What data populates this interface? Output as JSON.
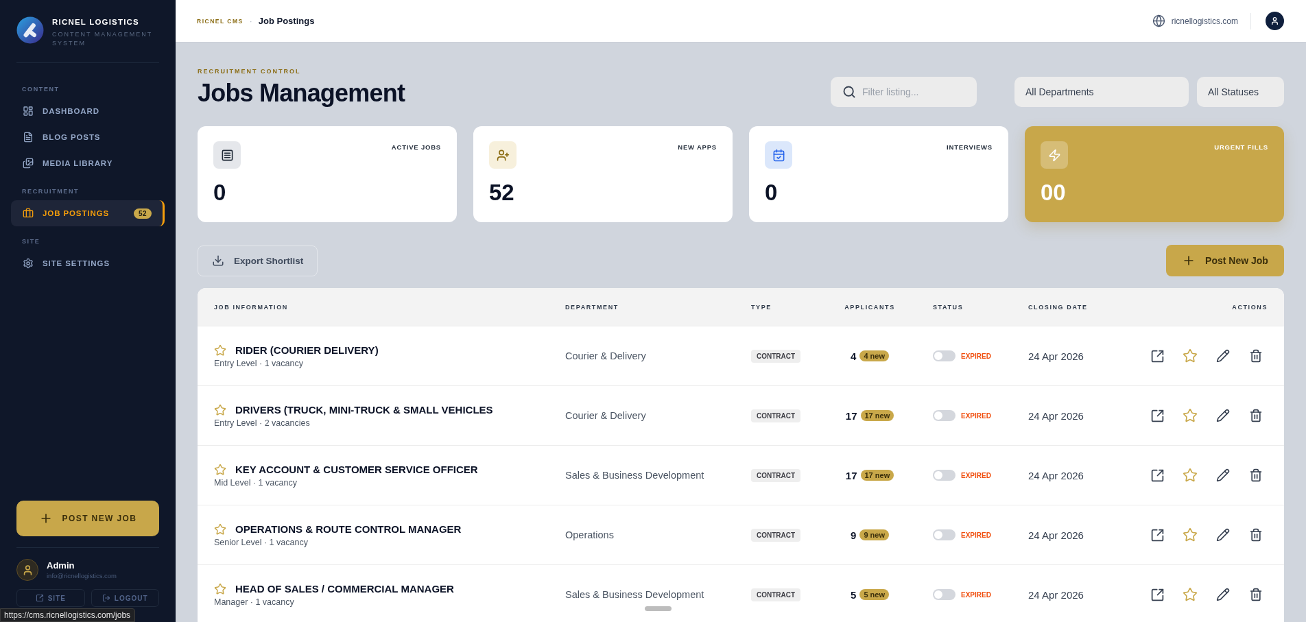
{
  "sidebar": {
    "brand": {
      "name": "RICNEL LOGISTICS",
      "tagline": "CONTENT MANAGEMENT SYSTEM"
    },
    "sections": [
      {
        "label": "CONTENT",
        "items": [
          {
            "label": "DASHBOARD",
            "kind": "dashboard",
            "selected": false
          },
          {
            "label": "BLOG POSTS",
            "kind": "article",
            "selected": false
          },
          {
            "label": "MEDIA LIBRARY",
            "kind": "media",
            "selected": false
          }
        ]
      },
      {
        "label": "RECRUITMENT",
        "items": [
          {
            "label": "JOB POSTINGS",
            "kind": "briefcase",
            "selected": true,
            "badge": "52"
          }
        ]
      },
      {
        "label": "SITE",
        "items": [
          {
            "label": "SITE SETTINGS",
            "kind": "settings",
            "selected": false
          }
        ]
      }
    ],
    "post_button": "POST NEW JOB",
    "user": {
      "name": "Admin",
      "email": "info@ricnellogistics.com"
    },
    "footer_buttons": [
      {
        "label": "SITE",
        "kind": "site"
      },
      {
        "label": "LOGOUT",
        "kind": "logout"
      }
    ]
  },
  "header": {
    "breadcrumb": [
      "RICNEL CMS",
      "Job Postings"
    ],
    "separator": "·",
    "site": "ricnellogistics.com"
  },
  "page": {
    "eyebrow": "RECRUITMENT CONTROL",
    "title": "Jobs Management",
    "search": {
      "placeholder": "Filter listing..."
    },
    "filters": [
      "All Departments",
      "All Statuses"
    ]
  },
  "stats": [
    {
      "label": "ACTIVE JOBS",
      "value": "0",
      "kind": "list",
      "highlighted": false
    },
    {
      "label": "NEW APPS",
      "value": "52",
      "kind": "user-plus",
      "highlighted": false
    },
    {
      "label": "INTERVIEWS",
      "value": "0",
      "kind": "calendar",
      "highlighted": false
    },
    {
      "label": "URGENT FILLS",
      "value": "00",
      "kind": "zap",
      "highlighted": true
    }
  ],
  "toolbar": {
    "export": "Export Shortlist",
    "post": "Post New Job"
  },
  "table": {
    "columns": [
      "JOB INFORMATION",
      "DEPARTMENT",
      "TYPE",
      "APPLICANTS",
      "STATUS",
      "CLOSING DATE",
      "ACTIONS"
    ],
    "rows": [
      {
        "title": "RIDER (COURIER DELIVERY)",
        "meta": "Entry Level · 1 vacancy",
        "featured": false,
        "department": "Courier & Delivery",
        "type": "CONTRACT",
        "applicants": "4",
        "new": "4 new",
        "on": false,
        "status": "EXPIRED",
        "closing_date": "24 Apr 2026"
      },
      {
        "title": "DRIVERS (TRUCK, MINI-TRUCK & SMALL VEHICLES",
        "meta": "Entry Level · 2 vacancies",
        "featured": false,
        "department": "Courier & Delivery",
        "type": "CONTRACT",
        "applicants": "17",
        "new": "17 new",
        "on": false,
        "status": "EXPIRED",
        "closing_date": "24 Apr 2026"
      },
      {
        "title": "KEY ACCOUNT & CUSTOMER SERVICE OFFICER",
        "meta": "Mid Level · 1 vacancy",
        "featured": false,
        "department": "Sales & Business Development",
        "type": "CONTRACT",
        "applicants": "17",
        "new": "17 new",
        "on": false,
        "status": "EXPIRED",
        "closing_date": "24 Apr 2026"
      },
      {
        "title": "OPERATIONS & ROUTE CONTROL MANAGER",
        "meta": "Senior Level · 1 vacancy",
        "featured": false,
        "department": "Operations",
        "type": "CONTRACT",
        "applicants": "9",
        "new": "9 new",
        "on": false,
        "status": "EXPIRED",
        "closing_date": "24 Apr 2026"
      },
      {
        "title": "HEAD OF SALES / COMMERCIAL MANAGER",
        "meta": "Manager · 1 vacancy",
        "featured": false,
        "department": "Sales & Business Development",
        "type": "CONTRACT",
        "applicants": "5",
        "new": "5 new",
        "on": false,
        "status": "EXPIRED",
        "closing_date": "24 Apr 2026"
      }
    ]
  },
  "browser_status": "https://cms.ricnellogistics.com/jobs"
}
